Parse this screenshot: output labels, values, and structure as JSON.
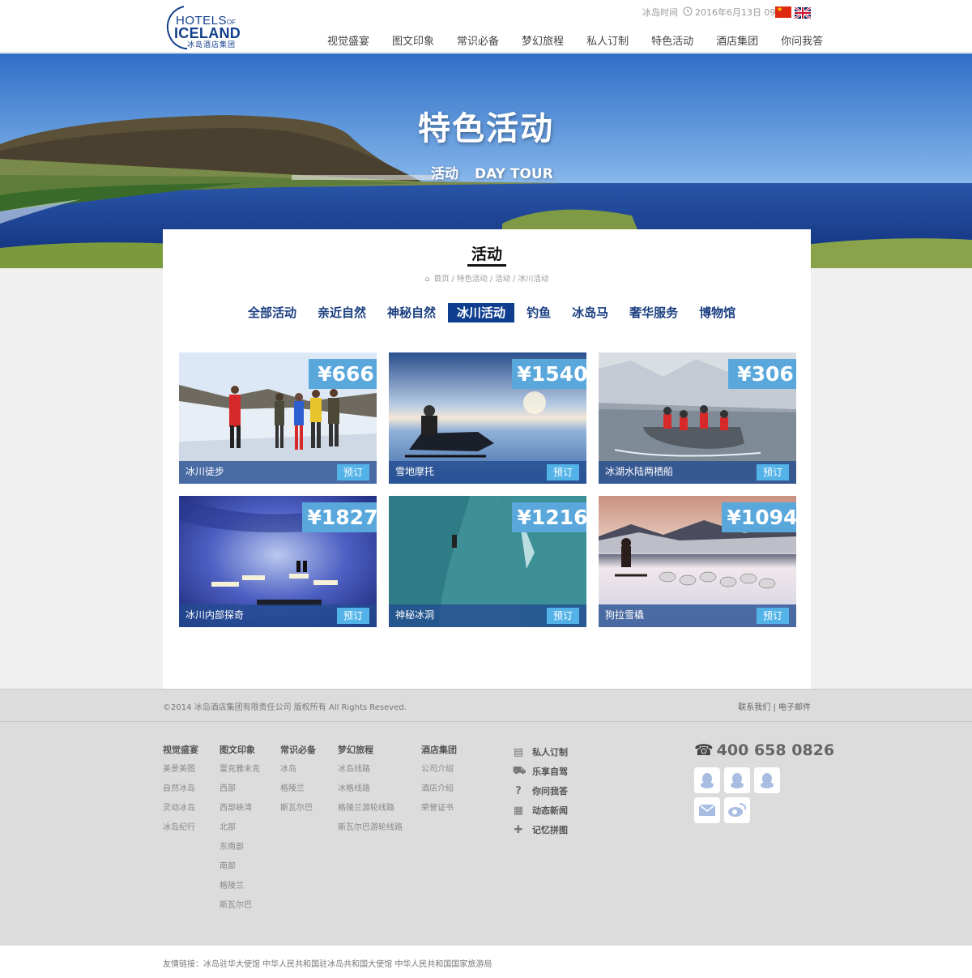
{
  "header": {
    "logo": {
      "line1": "HOTELS",
      "line1_of": "OF",
      "line2": "ICELAND",
      "line3": "冰岛酒店集团"
    },
    "time_label": "冰岛时间",
    "date": "2016年6月13日 09:33",
    "nav": [
      "视觉盛宴",
      "图文印象",
      "常识必备",
      "梦幻旅程",
      "私人订制",
      "特色活动",
      "酒店集团",
      "你问我答"
    ]
  },
  "banner": {
    "title": "特色活动",
    "sub_cn": "活动",
    "sub_en": "DAY TOUR"
  },
  "content": {
    "title": "活动",
    "breadcrumb": "首页 / 特色活动 / 活动 / 冰川活动",
    "tabs": [
      "全部活动",
      "亲近自然",
      "神秘自然",
      "冰川活动",
      "钓鱼",
      "冰岛马",
      "奢华服务",
      "博物馆"
    ],
    "active_tab": "冰川活动",
    "book_label": "预订",
    "activities": [
      {
        "name": "冰川徒步",
        "price": "¥666"
      },
      {
        "name": "雪地摩托",
        "price": "¥1540"
      },
      {
        "name": "冰湖水陆两栖船",
        "price": "¥306"
      },
      {
        "name": "冰川内部探奇",
        "price": "¥1827"
      },
      {
        "name": "神秘冰洞",
        "price": "¥1216"
      },
      {
        "name": "狗拉雪橇",
        "price": "¥1094"
      }
    ]
  },
  "footer": {
    "copyright": "©2014 冰岛酒店集团有限责任公司 版权所有 All Rights Reseved.",
    "links": "联系我们 | 电子邮件",
    "columns": [
      {
        "head": "视觉盛宴",
        "items": [
          "美景美图",
          "自然冰岛",
          "灵动冰岛",
          "冰岛纪行"
        ]
      },
      {
        "head": "图文印象",
        "items": [
          "雷克雅未克",
          "西部",
          "西部峡湾",
          "北部",
          "东南部",
          "南部",
          "格陵兰",
          "斯瓦尔巴"
        ]
      },
      {
        "head": "常识必备",
        "items": [
          "冰岛",
          "格陵兰",
          "斯瓦尔巴"
        ]
      },
      {
        "head": "梦幻旅程",
        "items": [
          "冰岛线路",
          "冰格线路",
          "格陵兰游轮线路",
          "斯瓦尔巴游轮线路"
        ]
      },
      {
        "head": "酒店集团",
        "items": [
          "公司介绍",
          "酒店介绍",
          "荣誉证书"
        ]
      }
    ],
    "quick_links": [
      "私人订制",
      "乐享自驾",
      "你问我答",
      "动态新闻",
      "记忆拼图"
    ],
    "phone": "400 658 0826",
    "friend_links": "友情链接：冰岛驻华大使馆  中华人民共和国驻冰岛共和国大使馆  中华人民共和国国家旅游局"
  },
  "colors": {
    "brand": "#123f8c",
    "active_tab": "#0f3e8e",
    "price": "#5aa7dc",
    "book": "#53b3e8"
  }
}
